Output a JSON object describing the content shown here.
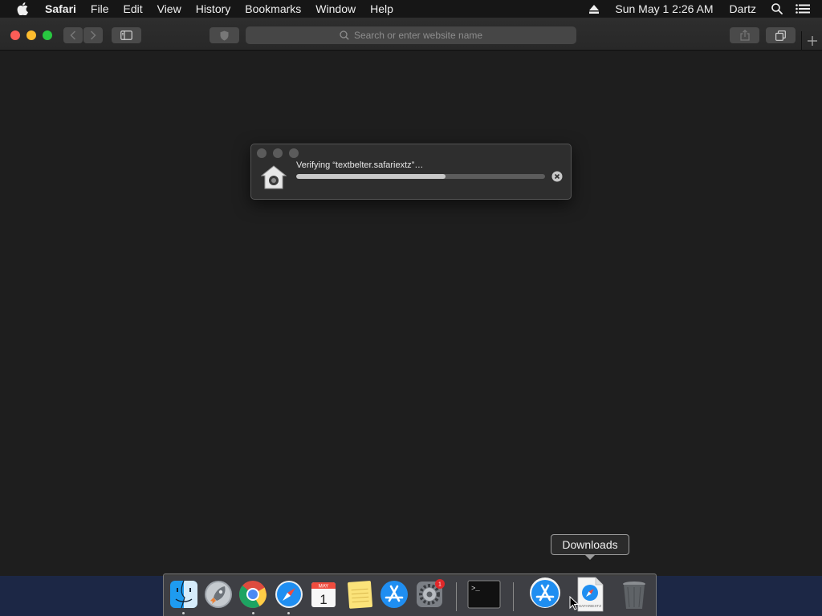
{
  "menubar": {
    "apple_icon": "apple-logo-icon",
    "app_name": "Safari",
    "items": [
      "File",
      "Edit",
      "View",
      "History",
      "Bookmarks",
      "Window",
      "Help"
    ],
    "clock": "Sun May 1  2:26 AM",
    "user": "Dartz",
    "status_icons": [
      "eject-icon",
      "spotlight-search-icon",
      "notification-center-icon"
    ]
  },
  "browser": {
    "address_placeholder": "Search or enter website name",
    "toolbar_icons": [
      "back-icon",
      "forward-icon",
      "sidebar-icon",
      "shield-icon",
      "share-icon",
      "tabs-overview-icon",
      "new-tab-icon"
    ]
  },
  "verify_dialog": {
    "title": "Verifying “textbelter.safariextz”…",
    "progress": 0.6,
    "icons": [
      "installer-icon",
      "cancel-icon"
    ]
  },
  "dock": {
    "tooltip": "Downloads",
    "apps": [
      {
        "name": "Finder",
        "running": true
      },
      {
        "name": "Launchpad",
        "running": false
      },
      {
        "name": "Google Chrome",
        "running": true
      },
      {
        "name": "Safari",
        "running": true
      },
      {
        "name": "Calendar",
        "running": false,
        "month": "MAY",
        "day": "1"
      },
      {
        "name": "Notes",
        "running": false
      },
      {
        "name": "App Store",
        "running": false
      },
      {
        "name": "System Preferences",
        "running": false,
        "badge": "1"
      },
      {
        "name": "Terminal",
        "running": false,
        "glyph": ">_"
      }
    ],
    "stacks": [
      {
        "name": "Applications"
      },
      {
        "name": "Downloads",
        "file_label": "SAFARIEXTZ"
      },
      {
        "name": "Trash"
      }
    ]
  },
  "colors": {
    "menubar_bg": "#161616",
    "window_bg": "#1e1e1e",
    "desktop_bg": "#1c2745",
    "close": "#fc5d57",
    "minimize": "#fdbc2e",
    "maximize": "#28c840",
    "badge_red": "#e0282a"
  }
}
